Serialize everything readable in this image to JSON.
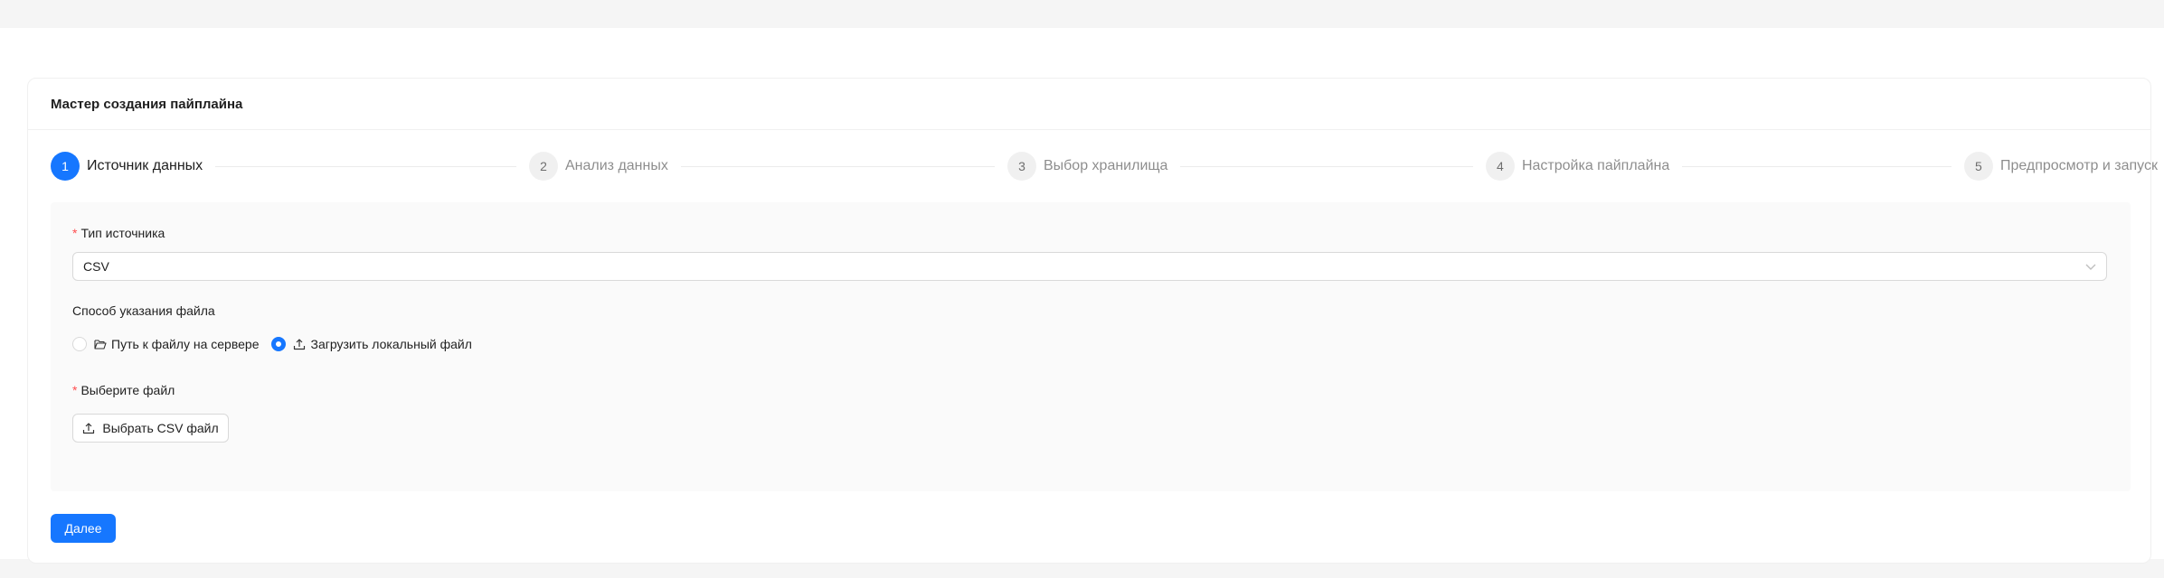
{
  "wizard": {
    "title": "Мастер создания пайплайна",
    "steps": [
      {
        "number": "1",
        "label": "Источник данных",
        "state": "active"
      },
      {
        "number": "2",
        "label": "Анализ данных",
        "state": "wait"
      },
      {
        "number": "3",
        "label": "Выбор хранилища",
        "state": "wait"
      },
      {
        "number": "4",
        "label": "Настройка пайплайна",
        "state": "wait"
      },
      {
        "number": "5",
        "label": "Предпросмотр и запуск",
        "state": "wait"
      }
    ]
  },
  "form": {
    "source_type": {
      "required_mark": "*",
      "label": "Тип источника",
      "value": "CSV",
      "icon": "chevron-down-icon"
    },
    "file_method": {
      "label": "Способ указания файла",
      "options": [
        {
          "label": "Путь к файлу на сервере",
          "icon": "folder-open-icon",
          "checked": false
        },
        {
          "label": "Загрузить локальный файл",
          "icon": "upload-icon",
          "checked": true
        }
      ]
    },
    "file_picker": {
      "required_mark": "*",
      "label": "Выберите файл",
      "button_label": "Выбрать CSV файл",
      "icon": "upload-icon"
    }
  },
  "actions": {
    "next_label": "Далее"
  },
  "colors": {
    "primary": "#1677ff",
    "required": "#ff4d4f",
    "panel_bg": "#fafafa",
    "page_bg": "#f5f5f5"
  }
}
